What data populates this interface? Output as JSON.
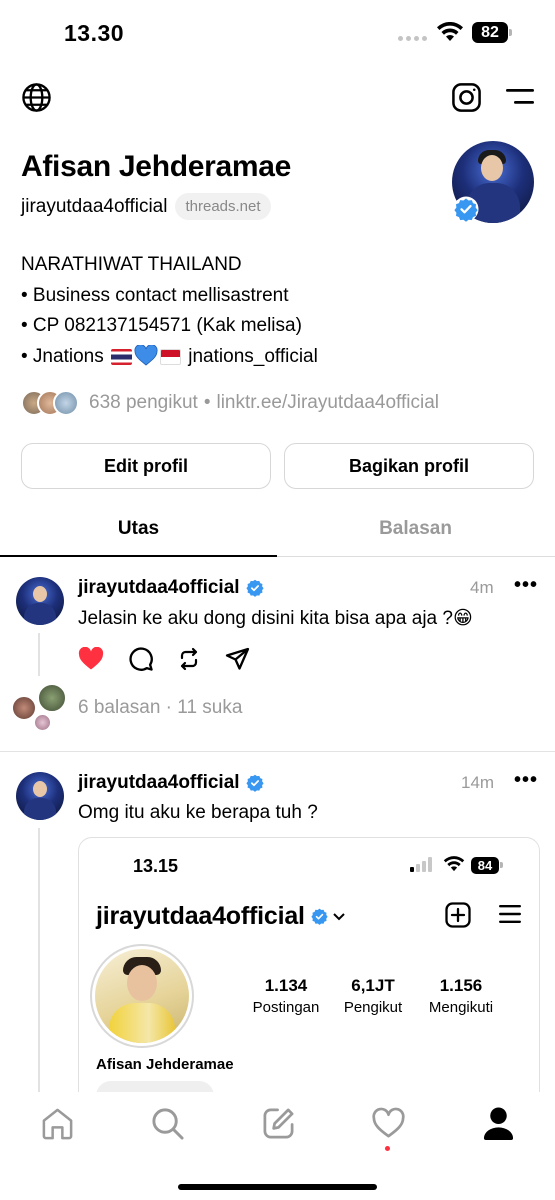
{
  "status_bar": {
    "time": "13.30",
    "battery": "82"
  },
  "profile": {
    "name": "Afisan Jehderamae",
    "handle": "jirayutdaa4official",
    "domain_badge": "threads.net",
    "bio": {
      "line1": "NARATHIWAT THAILAND",
      "line2": "• Business contact mellisastrent",
      "line3": "• CP 082137154571 (Kak melisa)",
      "line4_prefix": "• Jnations",
      "line4_suffix": "jnations_official"
    },
    "followers": "638 pengikut",
    "separator": "•",
    "link": "linktr.ee/Jirayutdaa4official",
    "edit_button": "Edit profil",
    "share_button": "Bagikan profil"
  },
  "tabs": {
    "threads": "Utas",
    "replies": "Balasan",
    "active": "Utas"
  },
  "posts": [
    {
      "username": "jirayutdaa4official",
      "time": "4m",
      "more": "•••",
      "text": "Jelasin ke aku dong disini kita bisa apa aja ?😁",
      "liked": true,
      "stats": "6 balasan · 11 suka"
    },
    {
      "username": "jirayutdaa4official",
      "time": "14m",
      "more": "•••",
      "text": "Omg itu aku ke berapa tuh ?",
      "embed": {
        "time": "13.15",
        "battery": "84",
        "username": "jirayutdaa4official",
        "posts_count": "1.134",
        "posts_label": "Postingan",
        "followers_count": "6,1JT",
        "followers_label": "Pengikut",
        "following_count": "1.156",
        "following_label": "Mengikuti",
        "display_name": "Afisan Jehderamae"
      }
    }
  ],
  "icons": {
    "top_left": "globe-icon",
    "top_right": [
      "instagram-icon",
      "menu-icon"
    ],
    "actions": [
      "heart-icon",
      "comment-icon",
      "repost-icon",
      "share-icon"
    ],
    "bottom_nav": [
      "home-icon",
      "search-icon",
      "compose-icon",
      "activity-heart-icon",
      "profile-icon"
    ]
  },
  "colors": {
    "verified": "#3897f0",
    "like": "#ff3040",
    "muted": "#999999"
  }
}
